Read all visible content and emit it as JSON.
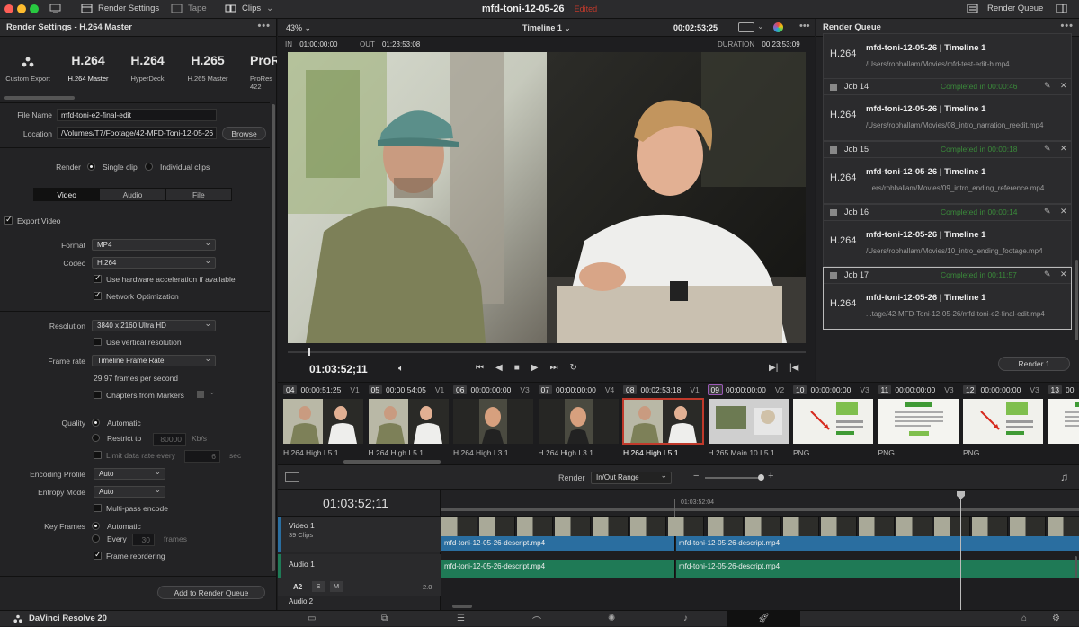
{
  "topbar": {
    "render_settings": "Render Settings",
    "tape": "Tape",
    "clips": "Clips",
    "project_title": "mfd-toni-12-05-26",
    "edited": "Edited",
    "render_queue": "Render Queue"
  },
  "render_settings": {
    "title": "Render Settings - H.264 Master",
    "presets": [
      {
        "big": "",
        "sub": "Custom Export",
        "icon": "custom-export-icon"
      },
      {
        "big": "H.264",
        "sub": "H.264 Master"
      },
      {
        "big": "H.264",
        "sub": "HyperDeck"
      },
      {
        "big": "H.265",
        "sub": "H.265 Master"
      },
      {
        "big": "ProRe",
        "sub": "ProRes 422"
      }
    ],
    "file_name_label": "File Name",
    "file_name": "mfd-toni-e2-final-edit",
    "location_label": "Location",
    "location": "/Volumes/T7/Footage/42-MFD-Toni-12-05-26",
    "browse": "Browse",
    "render_label": "Render",
    "single_clip": "Single clip",
    "individual_clips": "Individual clips",
    "tabs": [
      "Video",
      "Audio",
      "File"
    ],
    "export_video": "Export Video",
    "format_label": "Format",
    "format": "MP4",
    "codec_label": "Codec",
    "codec": "H.264",
    "hw_accel": "Use hardware acceleration if available",
    "network_opt": "Network Optimization",
    "resolution_label": "Resolution",
    "resolution": "3840 x 2160 Ultra HD",
    "vertical_res": "Use vertical resolution",
    "frame_rate_label": "Frame rate",
    "frame_rate": "Timeline Frame Rate",
    "fps_note": "29.97 frames per second",
    "chapters": "Chapters from Markers",
    "quality_label": "Quality",
    "automatic": "Automatic",
    "restrict_to": "Restrict to",
    "restrict_value": "80000",
    "kbs": "Kb/s",
    "limit_rate": "Limit data rate every",
    "limit_value": "6",
    "sec": "sec",
    "encoding_profile_label": "Encoding Profile",
    "encoding_profile": "Auto",
    "entropy_mode_label": "Entropy Mode",
    "entropy_mode": "Auto",
    "multipass": "Multi-pass encode",
    "key_frames_label": "Key Frames",
    "kf_automatic": "Automatic",
    "kf_every": "Every",
    "kf_every_value": "30",
    "frames": "frames",
    "frame_reordering": "Frame reordering",
    "add_to_queue": "Add to Render Queue"
  },
  "viewer": {
    "zoom": "43%",
    "timeline": "Timeline 1",
    "timecode_top": "00:02:53;25",
    "in_label": "IN",
    "in_tc": "01:00:00:00",
    "out_label": "OUT",
    "out_tc": "01:23:53:08",
    "duration_label": "DURATION",
    "duration": "00:23:53:09",
    "current_tc": "01:03:52;11",
    "playhead_fraction": 0.04
  },
  "render_queue": {
    "title": "Render Queue",
    "jobs": [
      {
        "job": "",
        "status": "",
        "codec": "H.264",
        "name": "mfd-toni-12-05-26 | Timeline 1",
        "path": "/Users/robhallam/Movies/mfd-test-edit-b.mp4"
      },
      {
        "job": "Job 14",
        "status": "Completed in 00:00:46",
        "codec": "H.264",
        "name": "mfd-toni-12-05-26 | Timeline 1",
        "path": "/Users/robhallam/Movies/08_intro_narration_reedit.mp4"
      },
      {
        "job": "Job 15",
        "status": "Completed in 00:00:18",
        "codec": "H.264",
        "name": "mfd-toni-12-05-26 | Timeline 1",
        "path": "...ers/robhallam/Movies/09_intro_ending_reference.mp4"
      },
      {
        "job": "Job 16",
        "status": "Completed in 00:00:14",
        "codec": "H.264",
        "name": "mfd-toni-12-05-26 | Timeline 1",
        "path": "/Users/robhallam/Movies/10_intro_ending_footage.mp4"
      },
      {
        "job": "Job 17",
        "status": "Completed in 00:11:57",
        "codec": "H.264",
        "name": "mfd-toni-12-05-26 | Timeline 1",
        "path": "...tage/42-MFD-Toni-12-05-26/mfd-toni-e2-final-edit.mp4"
      }
    ],
    "render_button": "Render 1"
  },
  "clips": [
    {
      "num": "04",
      "tc": "00:00:51:25",
      "track": "V1",
      "codec": "H.264 High L5.1",
      "kind": "interview"
    },
    {
      "num": "05",
      "tc": "00:00:54:05",
      "track": "V1",
      "codec": "H.264 High L5.1",
      "kind": "interview"
    },
    {
      "num": "06",
      "tc": "00:00:00:00",
      "track": "V3",
      "codec": "H.264 High L3.1",
      "kind": "selfie"
    },
    {
      "num": "07",
      "tc": "00:00:00:00",
      "track": "V4",
      "codec": "H.264 High L3.1",
      "kind": "selfie"
    },
    {
      "num": "08",
      "tc": "00:02:53:18",
      "track": "V1",
      "codec": "H.264 High L5.1",
      "kind": "interview",
      "selected": true
    },
    {
      "num": "09",
      "tc": "00:00:00:00",
      "track": "V2",
      "codec": "H.265 Main 10 L5.1",
      "kind": "laptop"
    },
    {
      "num": "10",
      "tc": "00:00:00:00",
      "track": "V3",
      "codec": "PNG",
      "kind": "doc-green"
    },
    {
      "num": "11",
      "tc": "00:00:00:00",
      "track": "V3",
      "codec": "PNG",
      "kind": "doc-white"
    },
    {
      "num": "12",
      "tc": "00:00:00:00",
      "track": "V3",
      "codec": "PNG",
      "kind": "doc-green"
    },
    {
      "num": "13",
      "tc": "00",
      "track": "",
      "codec": "",
      "kind": "doc-white"
    }
  ],
  "timeline": {
    "render_label": "Render",
    "render_range": "In/Out Range",
    "current_tc": "01:03:52;11",
    "ruler_tc": "01:03:52:04",
    "video_track": "Video 1",
    "video_clips": "39 Clips",
    "audio_track": "Audio 1",
    "audio_track2": "Audio 2",
    "a2": "A2",
    "s": "S",
    "m": "M",
    "level": "2.0",
    "clip_name_1": "mfd-toni-12-05-26-descript.mp4",
    "clip_name_2": "mfd-toni-12-05-26-descript.mp4"
  },
  "footer": {
    "app_name": "DaVinci Resolve 20"
  },
  "colors": {
    "video_clip": "#2a6ea0",
    "audio_clip": "#1f7a56",
    "status_green": "#3a8a3a",
    "edited_red": "#c0392b",
    "selected_clip": "#c0392b"
  }
}
